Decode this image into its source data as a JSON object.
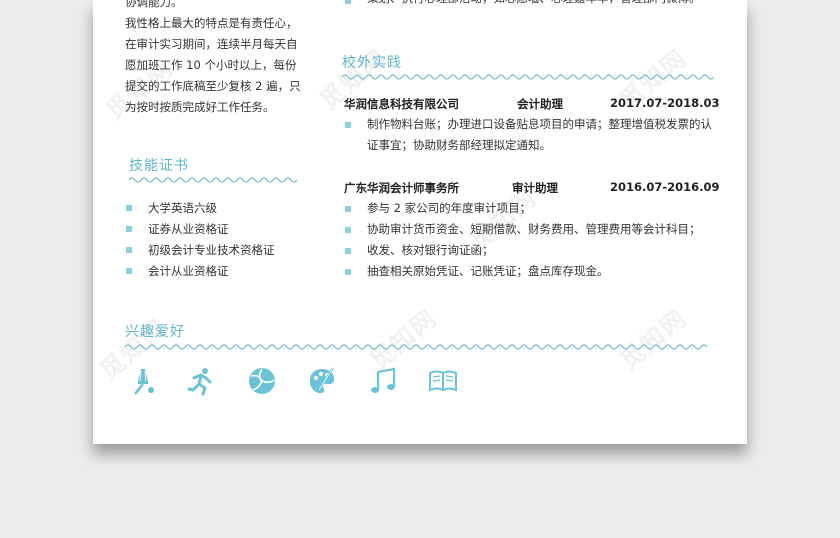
{
  "intro": {
    "lines": [
      "协调能力。",
      "我性格上最大的特点是有责任心，",
      "在审计实习期间，连续半月每天自",
      "愿加班工作 10 个小时以上，每份",
      "提交的工作底稿至少复核 2 遍，只",
      "为按时按质完成好工作任务。"
    ]
  },
  "top_right_line": "策划、执行心理部活动，如心愿墙、心理嘉年华，管理部门微博。",
  "skills": {
    "title": "技能证书",
    "items": [
      "大学英语六级",
      "证券从业资格证",
      "初级会计专业技术资格证",
      "会计从业资格证"
    ]
  },
  "practice": {
    "title": "校外实践",
    "jobs": [
      {
        "company": "华润信息科技有限公司",
        "role": "会计助理",
        "period": "2017.07-2018.03",
        "lines": [
          "制作物料台账；办理进口设备贴息项目的申请；整理增值税发票的认",
          "证事宜；协助财务部经理拟定通知。"
        ]
      },
      {
        "company": "广东华润会计师事务所",
        "role": "审计助理",
        "period": "2016.07-2016.09",
        "lines": [
          "参与 2 家公司的年度审计项目；",
          "协助审计货币资金、短期借款、财务费用、管理费用等会计科目；",
          "收发、核对银行询证函；",
          "抽查相关原始凭证、记账凭证；盘点库存现金。"
        ]
      }
    ]
  },
  "hobbies": {
    "title": "兴趣爱好",
    "icons": [
      "badminton-icon",
      "running-icon",
      "volleyball-icon",
      "painting-icon",
      "music-icon",
      "reading-icon"
    ]
  },
  "watermark": "觅知网",
  "colors": {
    "accent": "#5fb6c8",
    "bullet": "#8ecfdc",
    "icon": "#6cc3d6"
  }
}
